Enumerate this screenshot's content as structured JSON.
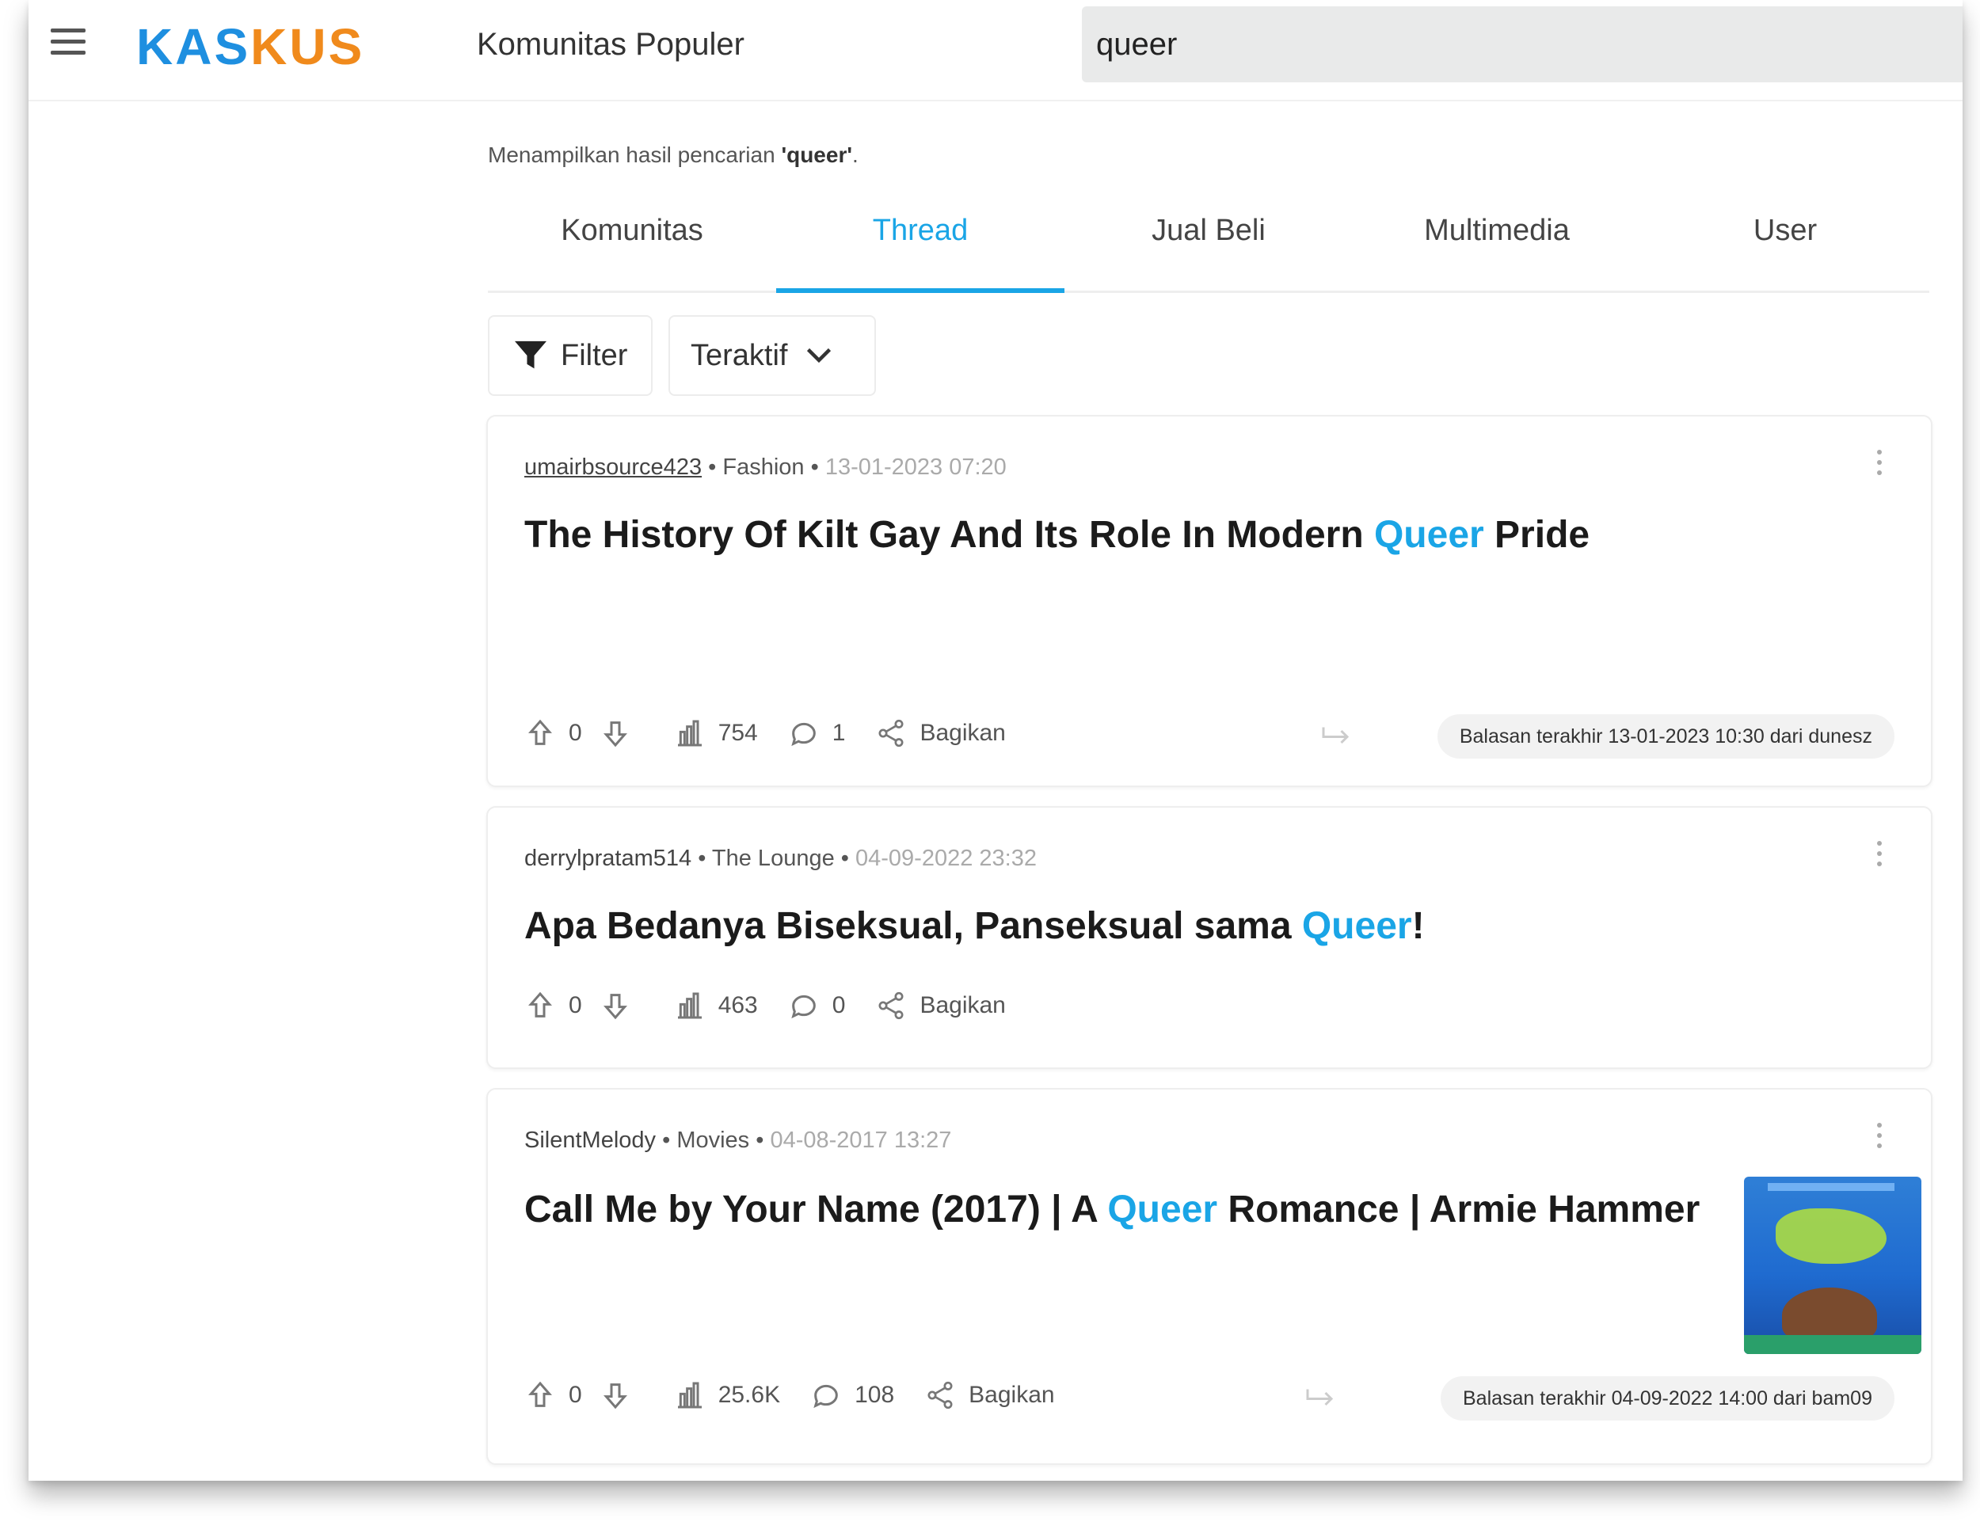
{
  "header": {
    "logo": "KASKUS",
    "nav_title": "Komunitas Populer",
    "search_value": "queer"
  },
  "results_note": {
    "prefix": "Menampilkan hasil pencarian ",
    "query": "'queer'",
    "suffix": "."
  },
  "tabs": [
    "Komunitas",
    "Thread",
    "Jual Beli",
    "Multimedia",
    "User"
  ],
  "active_tab": "Thread",
  "filters": {
    "filter_label": "Filter",
    "sort_label": "Teraktif"
  },
  "threads": [
    {
      "user": "umairbsource423",
      "community": "Fashion",
      "date": "13-01-2023 07:20",
      "title_before": "The History Of Kilt Gay And Its Role In Modern ",
      "title_highlight": "Queer",
      "title_after": " Pride",
      "upvotes": "0",
      "views": "754",
      "comments": "1",
      "share_label": "Bagikan",
      "last_reply": "Balasan terakhir 13-01-2023 10:30 dari dunesz"
    },
    {
      "user": "derrylpratam514",
      "community": "The Lounge",
      "date": "04-09-2022 23:32",
      "title_before": "Apa Bedanya Biseksual, Panseksual sama ",
      "title_highlight": "Queer",
      "title_after": "!",
      "upvotes": "0",
      "views": "463",
      "comments": "0",
      "share_label": "Bagikan"
    },
    {
      "user": "SilentMelody",
      "community": "Movies",
      "date": "04-08-2017 13:27",
      "title_before": "Call Me by Your Name (2017) | A ",
      "title_highlight": "Queer",
      "title_after": " Romance | Armie Hammer",
      "upvotes": "0",
      "views": "25.6K",
      "comments": "108",
      "share_label": "Bagikan",
      "last_reply": "Balasan terakhir 04-09-2022 14:00 dari bam09"
    }
  ],
  "colors": {
    "accent": "#1aa5e6",
    "logo_blue": "#1e8fe0",
    "logo_orange": "#f08a1c"
  }
}
